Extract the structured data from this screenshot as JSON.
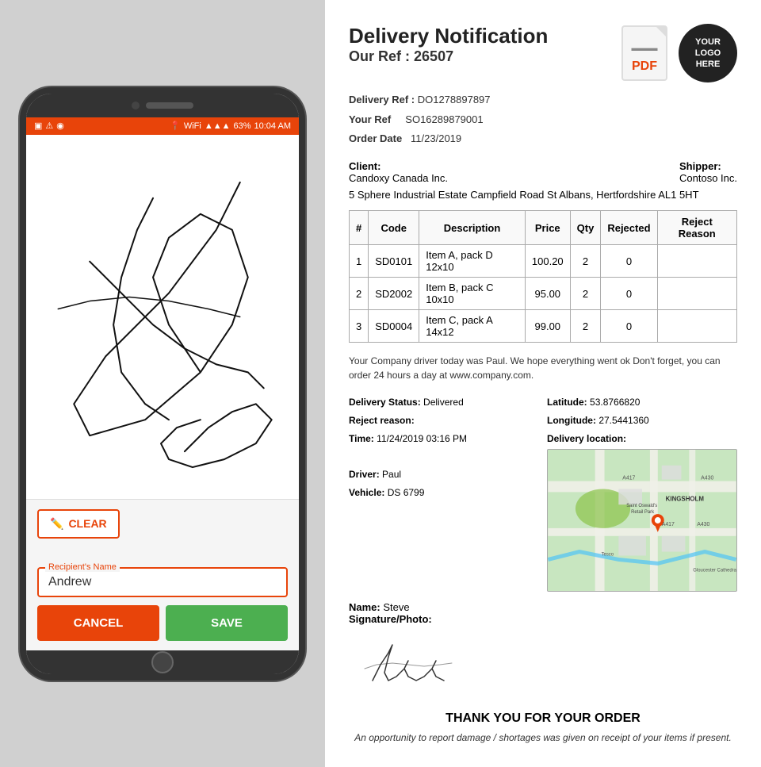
{
  "phone": {
    "status_bar": {
      "time": "10:04 AM",
      "battery": "63%",
      "signal": "●●●",
      "wifi": "WiFi"
    },
    "clear_button": "CLEAR",
    "cancel_button": "CANCEL",
    "save_button": "SAVE",
    "recipient_name_label": "Recipient's Name",
    "recipient_name_value": "Andrew"
  },
  "document": {
    "title": "Delivery Notification",
    "ref_label": "Our Ref :",
    "ref_value": "26507",
    "delivery_ref_label": "Delivery Ref :",
    "delivery_ref_value": "DO1278897897",
    "your_ref_label": "Your Ref",
    "your_ref_value": "SO16289879001",
    "order_date_label": "Order Date",
    "order_date_value": "11/23/2019",
    "client_label": "Client:",
    "client_name": "Candoxy Canada Inc.",
    "client_address": "5 Sphere Industrial Estate Campfield Road St Albans, Hertfordshire AL1 5HT",
    "shipper_label": "Shipper:",
    "shipper_name": "Contoso Inc.",
    "table": {
      "headers": [
        "#",
        "Code",
        "Description",
        "Price",
        "Qty",
        "Rejected",
        "Reject Reason"
      ],
      "rows": [
        {
          "num": "1",
          "code": "SD0101",
          "desc": "Item A, pack D 12x10",
          "price": "100.20",
          "qty": "2",
          "rejected": "0",
          "reason": ""
        },
        {
          "num": "2",
          "code": "SD2002",
          "desc": "Item B, pack C 10x10",
          "price": "95.00",
          "qty": "2",
          "rejected": "0",
          "reason": ""
        },
        {
          "num": "3",
          "code": "SD0004",
          "desc": "Item C, pack A 14x12",
          "price": "99.00",
          "qty": "2",
          "rejected": "0",
          "reason": ""
        }
      ]
    },
    "note": "Your Company driver today was Paul. We hope everything went ok  Don't forget, you can order 24 hours a day at www.company.com.",
    "delivery_status_label": "Delivery Status:",
    "delivery_status_value": "Delivered",
    "reject_reason_label": "Reject reason:",
    "reject_reason_value": "",
    "time_label": "Time:",
    "time_value": "11/24/2019 03:16 PM",
    "driver_label": "Driver:",
    "driver_value": "Paul",
    "vehicle_label": "Vehicle:",
    "vehicle_value": "DS 6799",
    "latitude_label": "Latitude:",
    "latitude_value": "53.8766820",
    "longitude_label": "Longitude:",
    "longitude_value": "27.5441360",
    "delivery_location_label": "Delivery location:",
    "name_label": "Name:",
    "name_value": "Steve",
    "sig_label": "Signature/Photo:",
    "pdf_label": "PDF",
    "logo_line1": "YOUR",
    "logo_line2": "LOGO",
    "logo_line3": "HERE",
    "thank_you": "THANK YOU FOR YOUR ORDER",
    "footer_note": "An opportunity to report damage / shortages was given on receipt of your items if present."
  }
}
